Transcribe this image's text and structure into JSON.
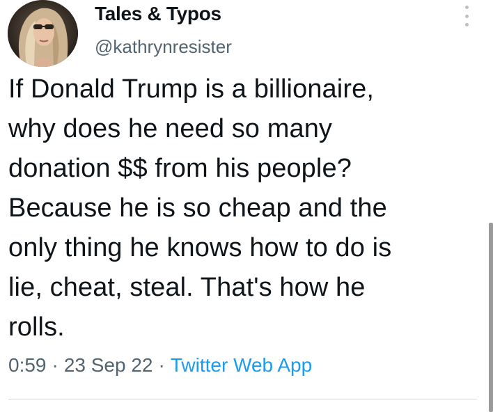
{
  "author": {
    "display_name": "Tales & Typos",
    "handle": "@kathrynresister",
    "avatar_icon": "profile-photo"
  },
  "tweet": {
    "text_lines": [
      "If Donald Trump is a billionaire,",
      "why does he need so many",
      "donation $$ from his people?",
      "Because he is so cheap and the",
      "only thing he knows how to do is",
      "lie, cheat, steal. That's how he",
      "rolls."
    ],
    "time": "0:59",
    "date": "23 Sep 22",
    "separator": "·",
    "source": "Twitter Web App"
  },
  "colors": {
    "text": "#0f1419",
    "secondary": "#536471",
    "link": "#1d9bf0"
  },
  "icons": {
    "more": "more-vertical-icon"
  }
}
